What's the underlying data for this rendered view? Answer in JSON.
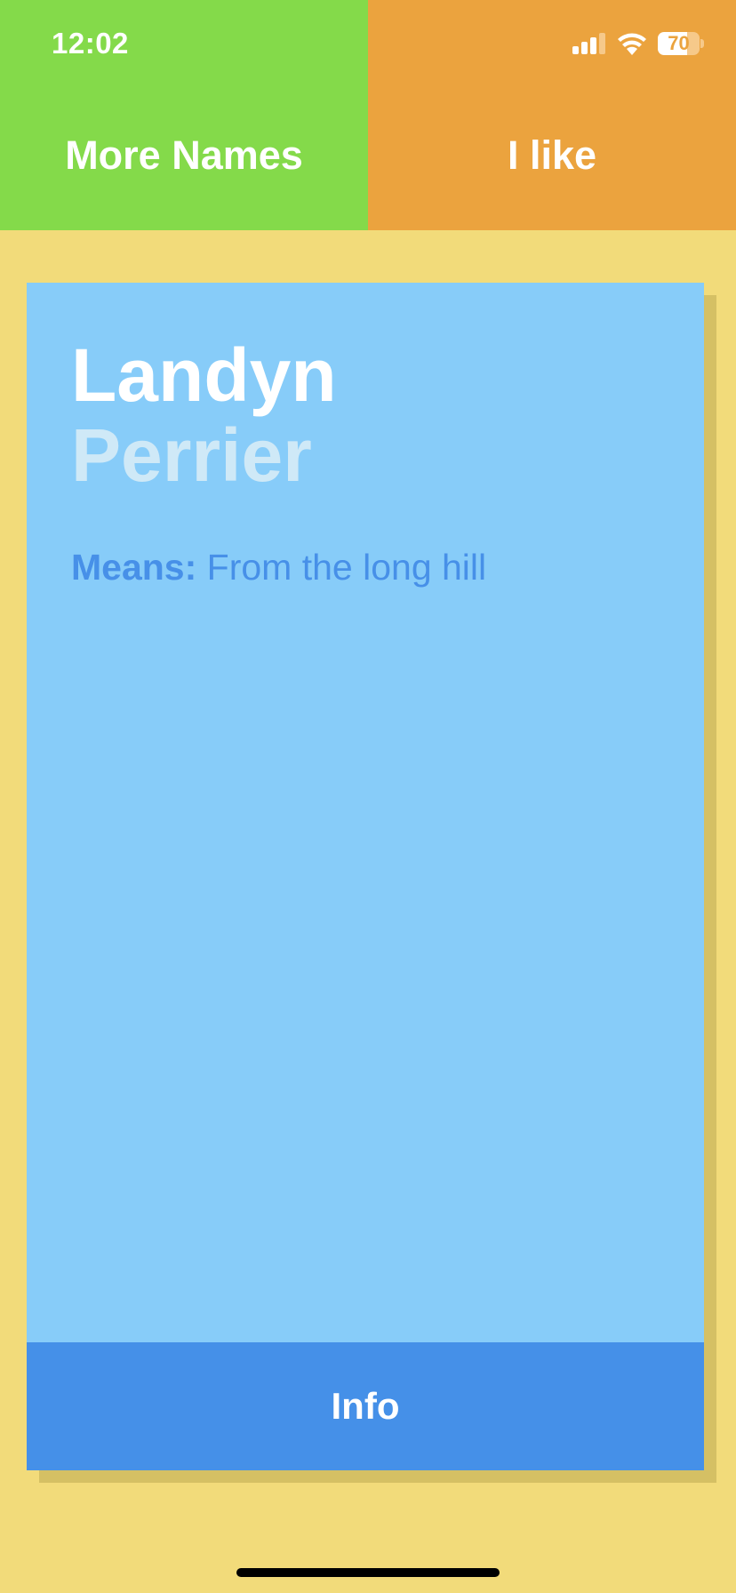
{
  "status_bar": {
    "time": "12:02",
    "battery_level": "70",
    "battery_fraction": 0.7
  },
  "header": {
    "more_names_label": "More Names",
    "i_like_label": "I like",
    "colors": {
      "left": "#84DA4A",
      "right": "#EBA33E"
    }
  },
  "card": {
    "first_name": "Landyn",
    "last_name": "Perrier",
    "meaning_label": "Means:",
    "meaning_text": "From the long hill",
    "info_button_label": "Info",
    "colors": {
      "card": "#87CCF9",
      "accent": "#4590E8"
    }
  },
  "background_color": "#F2DB7A"
}
